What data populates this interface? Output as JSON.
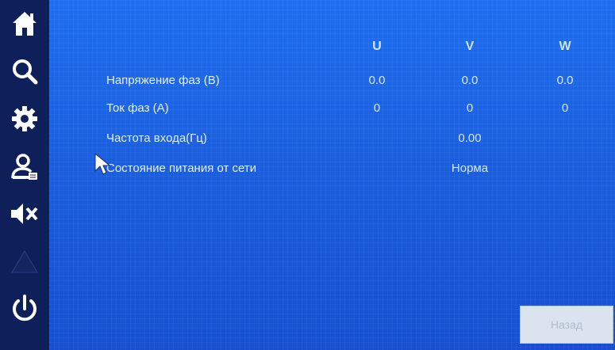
{
  "sidebar": {
    "items": [
      {
        "icon": "home-icon"
      },
      {
        "icon": "search-icon"
      },
      {
        "icon": "gear-icon"
      },
      {
        "icon": "user-icon"
      },
      {
        "icon": "mute-icon"
      },
      {
        "icon": "warning-icon"
      },
      {
        "icon": "power-icon"
      }
    ]
  },
  "table": {
    "columns": [
      "U",
      "V",
      "W"
    ],
    "rows": [
      {
        "label": "Напряжение фаз (В)",
        "u": "0.0",
        "v": "0.0",
        "w": "0.0"
      },
      {
        "label": "Ток фаз (А)",
        "u": "0",
        "v": "0",
        "w": "0"
      },
      {
        "label": "Частота входа(Гц)",
        "value": "0.00"
      },
      {
        "label": "Состояние питания от сети",
        "value": "Норма"
      }
    ]
  },
  "footer": {
    "back_label": "Назад"
  },
  "colors": {
    "background": "#1d6ef0",
    "sidebar": "#0e1f5a",
    "text": "#e6f0ff"
  }
}
